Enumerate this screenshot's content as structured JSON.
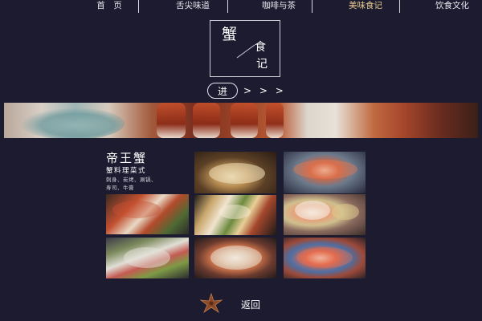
{
  "nav": {
    "items": [
      {
        "label": "首　页",
        "active": false
      },
      {
        "label": "舌尖味道",
        "active": false
      },
      {
        "label": "咖啡与茶",
        "active": false
      },
      {
        "label": "美味食记",
        "active": true
      },
      {
        "label": "饮食文化",
        "active": false
      }
    ]
  },
  "title_box": {
    "char1": "蟹",
    "char2": "食",
    "char3": "记"
  },
  "enter": {
    "label": "进",
    "arrows": "> > >"
  },
  "feature": {
    "title": "帝王蟹",
    "subtitle": "蟹料理菜式",
    "desc_line1": "刺身、炭烤、涮锅、",
    "desc_line2": "寿司、牛膏"
  },
  "return": {
    "label": "返回"
  },
  "colors": {
    "background": "#1c1b30",
    "active_nav": "#e9c98f",
    "text": "#ffffff"
  }
}
